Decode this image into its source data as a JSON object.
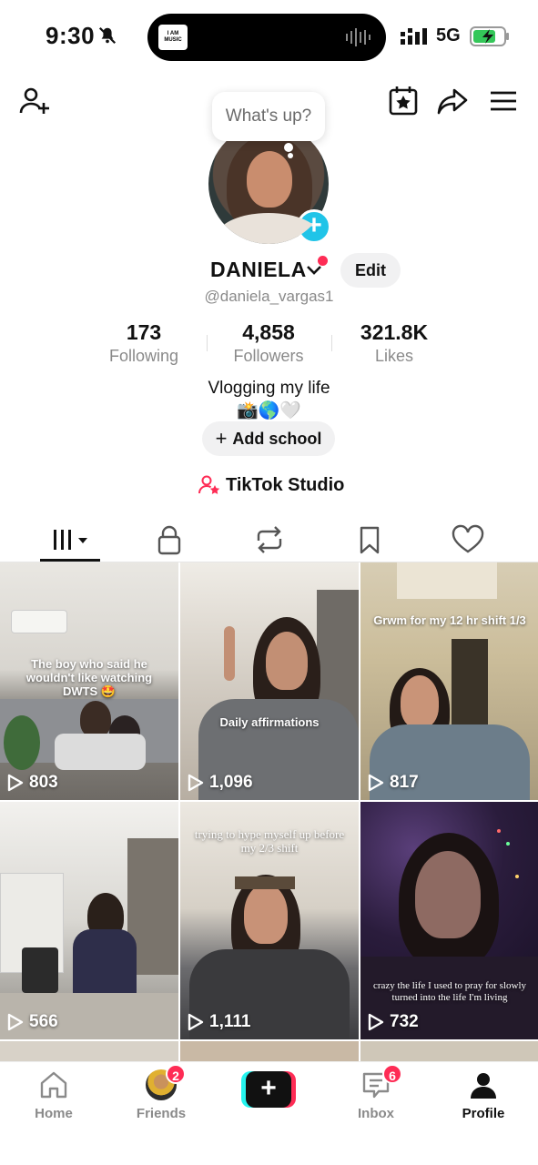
{
  "status_bar": {
    "time": "9:30",
    "network": "5G",
    "island_app_label": "I AM MUSIC"
  },
  "profile": {
    "bubble_text": "What's up?",
    "name": "DANIELA",
    "edit_label": "Edit",
    "handle": "@daniela_vargas1",
    "stats": [
      {
        "value": "173",
        "label": "Following"
      },
      {
        "value": "4,858",
        "label": "Followers"
      },
      {
        "value": "321.8K",
        "label": "Likes"
      }
    ],
    "bio_line1": "Vlogging my life",
    "bio_line2": "📸🌎🤍",
    "add_school_label": "Add school",
    "studio_label": "TikTok Studio"
  },
  "tabs": [
    "videos-tab",
    "private-tab",
    "reposts-tab",
    "saved-tab",
    "liked-tab"
  ],
  "videos": [
    {
      "caption": "The boy who said he wouldn't like watching DWTS 🤩",
      "views": "803"
    },
    {
      "caption": "Daily affirmations",
      "views": "1,096"
    },
    {
      "caption": "Grwm for my 12 hr shift 1/3",
      "views": "817"
    },
    {
      "caption": "",
      "views": "566"
    },
    {
      "caption": "trying to hype myself up before my 2/3 shift",
      "views": "1,111"
    },
    {
      "caption": "crazy the life I used to pray for slowly turned into the life I'm living",
      "views": "732"
    }
  ],
  "bottom_nav": {
    "home": "Home",
    "friends": "Friends",
    "friends_badge": "2",
    "inbox": "Inbox",
    "inbox_badge": "6",
    "profile": "Profile"
  },
  "colors": {
    "accent_red": "#fe2c55",
    "accent_cyan": "#25f4ee",
    "avatar_plus": "#20c4e8"
  }
}
